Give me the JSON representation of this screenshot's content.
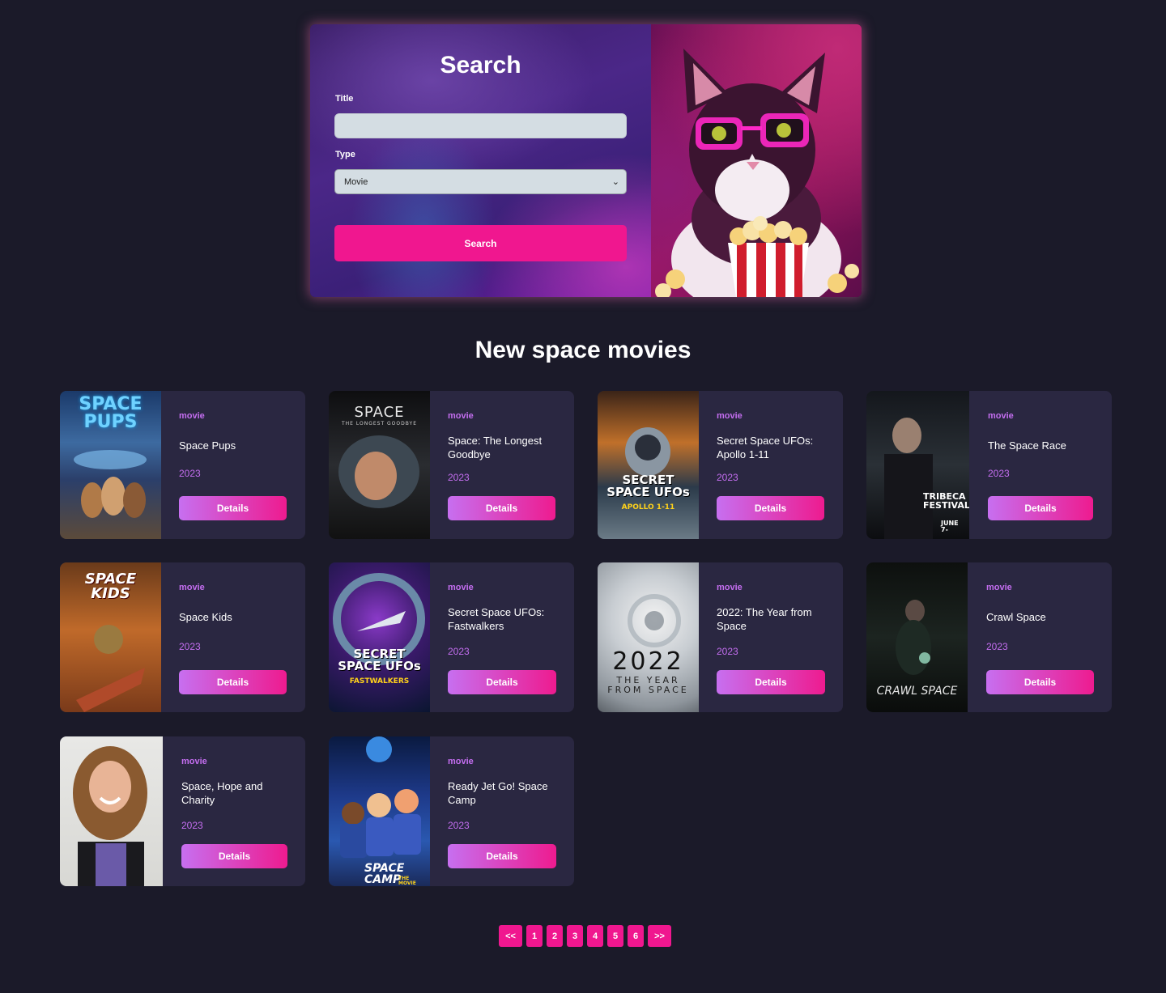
{
  "search": {
    "title": "Search",
    "title_label": "Title",
    "title_value": "",
    "type_label": "Type",
    "type_value": "Movie",
    "button": "Search"
  },
  "section_title": "New space movies",
  "movies": [
    {
      "type": "movie",
      "title": "Space Pups",
      "year": "2023",
      "button": "Details",
      "poster_text": "SPACE PUPS"
    },
    {
      "type": "movie",
      "title": "Space: The Longest Goodbye",
      "year": "2023",
      "button": "Details",
      "poster_text": "SPACE",
      "poster_subtext": "THE LONGEST GOODBYE"
    },
    {
      "type": "movie",
      "title": "Secret Space UFOs: Apollo 1-11",
      "year": "2023",
      "button": "Details",
      "poster_text": "SECRET SPACE UFOs",
      "poster_subtext": "APOLLO 1-11"
    },
    {
      "type": "movie",
      "title": "The Space Race",
      "year": "2023",
      "button": "Details",
      "poster_text": "TRIBECA FESTIVAL",
      "poster_subtext": "JUNE 7-"
    },
    {
      "type": "movie",
      "title": "Space Kids",
      "year": "2023",
      "button": "Details",
      "poster_text": "SPACE KIDS"
    },
    {
      "type": "movie",
      "title": "Secret Space UFOs: Fastwalkers",
      "year": "2023",
      "button": "Details",
      "poster_text": "SECRET SPACE UFOs",
      "poster_subtext": "FASTWALKERS"
    },
    {
      "type": "movie",
      "title": "2022: The Year from Space",
      "year": "2023",
      "button": "Details",
      "poster_text": "2022",
      "poster_subtext": "THE YEAR FROM SPACE"
    },
    {
      "type": "movie",
      "title": "Crawl Space",
      "year": "2023",
      "button": "Details",
      "poster_text": "CRAWL SPACE"
    },
    {
      "type": "movie",
      "title": "Space, Hope and Charity",
      "year": "2023",
      "button": "Details"
    },
    {
      "type": "movie",
      "title": "Ready Jet Go! Space Camp",
      "year": "2023",
      "button": "Details",
      "poster_text": "SPACE CAMP",
      "poster_subtext": "THE MOVIE"
    }
  ],
  "pagination": {
    "prev": "<<",
    "pages": [
      "1",
      "2",
      "3",
      "4",
      "5",
      "6"
    ],
    "next": ">>"
  }
}
